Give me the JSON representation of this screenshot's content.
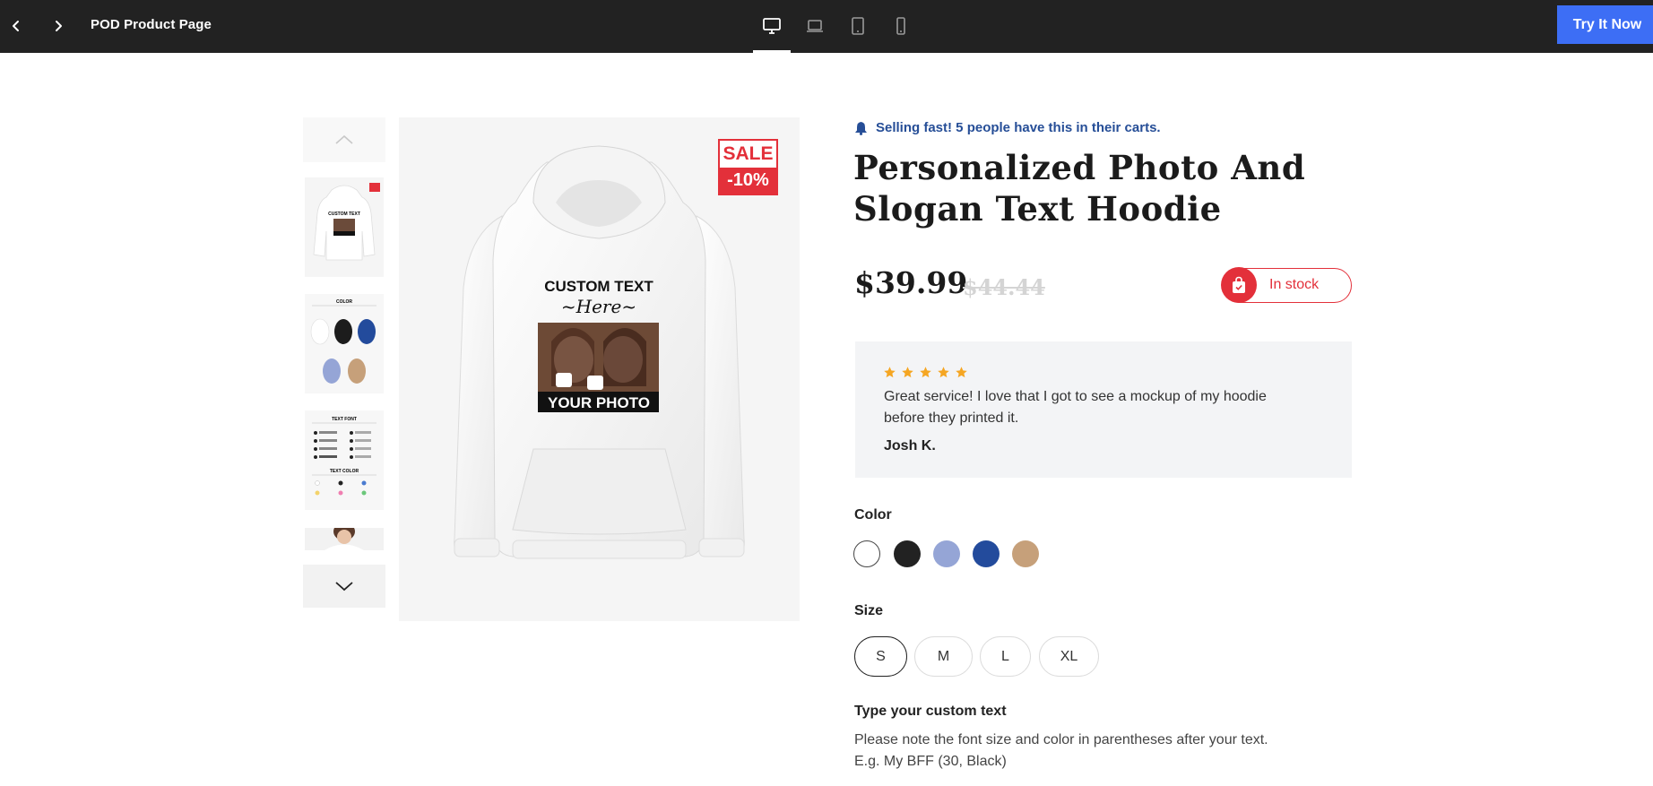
{
  "topbar": {
    "page_name": "POD Product Page",
    "try_button": "Try It Now",
    "devices": [
      "desktop-icon",
      "laptop-icon",
      "tablet-icon",
      "mobile-icon"
    ]
  },
  "gallery": {
    "main_print_title": "CUSTOM TEXT",
    "main_print_script": "~Here~",
    "main_print_photo_label": "YOUR PHOTO",
    "sale_badge_top": "SALE",
    "sale_badge_bottom": "-10%",
    "thumb_color_title": "COLOR",
    "thumb_font_title": "TEXT FONT",
    "thumb_textcolor_title": "TEXT COLOR"
  },
  "product": {
    "urgency": "Selling fast! 5 people have this in their carts.",
    "title": "Personalized Photo And Slogan Text Hoodie",
    "price": "$39.99",
    "old_price": "$44.44",
    "stock": "In stock"
  },
  "review": {
    "stars": 5,
    "text": "Great service! I love that I got to see a mockup of my hoodie before they printed it.",
    "author": "Josh K."
  },
  "options": {
    "color_label": "Color",
    "colors": [
      "#ffffff",
      "#222222",
      "#95a5d6",
      "#234b9c",
      "#c6a07a"
    ],
    "size_label": "Size",
    "sizes": [
      "S",
      "M",
      "L",
      "XL"
    ],
    "selected_size": "S",
    "custom_text_label": "Type your custom text",
    "custom_text_note_1": "Please note the font size and color in parentheses after your text.",
    "custom_text_note_2": "E.g. My BFF (30, Black)"
  },
  "colors": {
    "topbar": "#222222",
    "accent_blue": "#3d6ef5",
    "sale_red": "#e3303a",
    "urgency_blue": "#264e97",
    "star": "#f5a623"
  }
}
